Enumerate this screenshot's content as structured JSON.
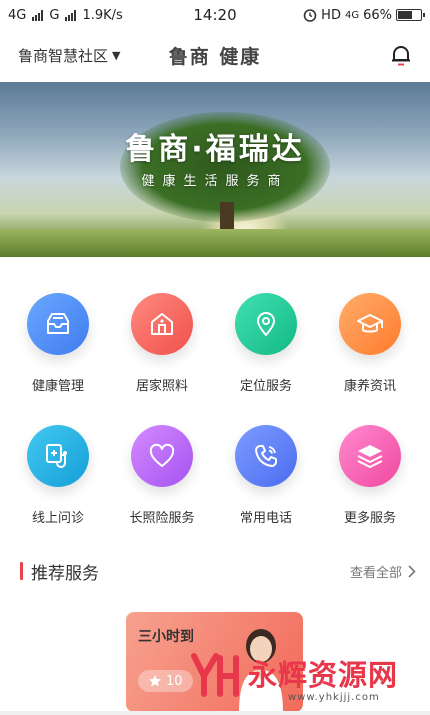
{
  "status_bar": {
    "net1": "4G",
    "net2": "G",
    "speed": "1.9K/s",
    "time": "14:20",
    "hd": "HD",
    "net3": "4G",
    "battery": "66%",
    "battery_level": 0.66
  },
  "header": {
    "community": "鲁商智慧社区",
    "brand": "鲁商 健康"
  },
  "banner": {
    "title": "鲁商·福瑞达",
    "subtitle": "健康生活服务商"
  },
  "services": [
    {
      "label": "健康管理",
      "icon": "tray-icon",
      "color_from": "#6aa8ff",
      "color_to": "#3f7cf0"
    },
    {
      "label": "居家照料",
      "icon": "home-icon",
      "color_from": "#ff8a80",
      "color_to": "#f0504a"
    },
    {
      "label": "定位服务",
      "icon": "location-pin-icon",
      "color_from": "#3fe0b0",
      "color_to": "#14b985"
    },
    {
      "label": "康养资讯",
      "icon": "graduation-cap-icon",
      "color_from": "#ffad6a",
      "color_to": "#ff7b2e"
    },
    {
      "label": "线上问诊",
      "icon": "stethoscope-icon",
      "color_from": "#44c8f0",
      "color_to": "#149fd8"
    },
    {
      "label": "长照险服务",
      "icon": "heart-icon",
      "color_from": "#d48bff",
      "color_to": "#a552f0"
    },
    {
      "label": "常用电话",
      "icon": "phone-icon",
      "color_from": "#7c9cff",
      "color_to": "#4b6cf0"
    },
    {
      "label": "更多服务",
      "icon": "layers-icon",
      "color_from": "#ff8ad0",
      "color_to": "#f0489e"
    }
  ],
  "recommend": {
    "title": "推荐服务",
    "more": "查看全部",
    "card": {
      "title": "三小时到",
      "badge": "10"
    }
  },
  "watermark": {
    "text": "永辉资源网",
    "url": "www.yhkjjj.com"
  }
}
